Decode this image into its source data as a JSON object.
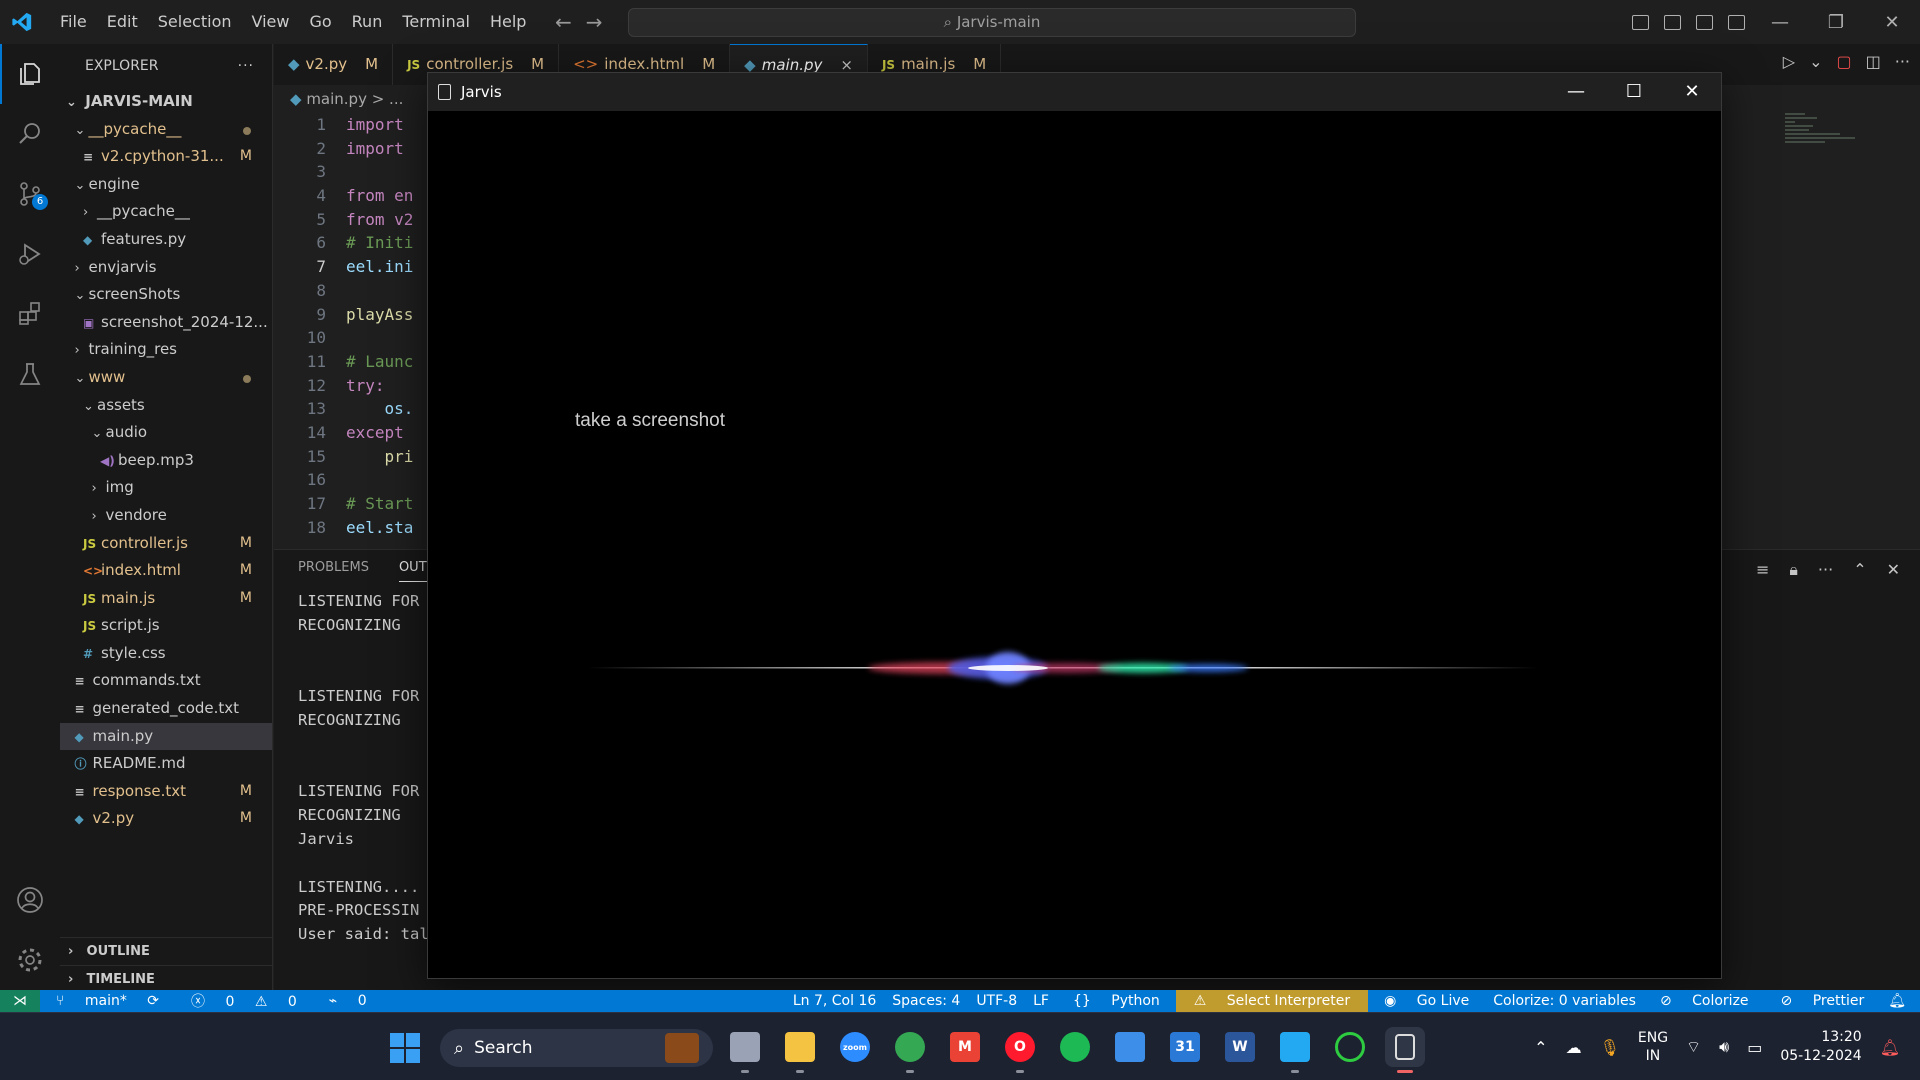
{
  "menu": [
    "File",
    "Edit",
    "Selection",
    "View",
    "Go",
    "Run",
    "Terminal",
    "Help"
  ],
  "command_center": "Jarvis-main",
  "explorer": {
    "title": "EXPLORER",
    "root": "JARVIS-MAIN",
    "items": [
      {
        "label": "__pycache__",
        "indent": 1,
        "kind": "folder-open",
        "mark": "dot",
        "mod": true
      },
      {
        "label": "v2.cpython-31...",
        "indent": 2,
        "kind": "file",
        "icon": "≡",
        "mark": "M",
        "mod": true
      },
      {
        "label": "engine",
        "indent": 1,
        "kind": "folder-open"
      },
      {
        "label": "__pycache__",
        "indent": 2,
        "kind": "folder"
      },
      {
        "label": "features.py",
        "indent": 2,
        "kind": "file",
        "icon": "py"
      },
      {
        "label": "envjarvis",
        "indent": 1,
        "kind": "folder"
      },
      {
        "label": "screenShots",
        "indent": 1,
        "kind": "folder-open"
      },
      {
        "label": "screenshot_2024-12...",
        "indent": 2,
        "kind": "file",
        "icon": "img"
      },
      {
        "label": "training_res",
        "indent": 1,
        "kind": "folder"
      },
      {
        "label": "www",
        "indent": 1,
        "kind": "folder-open",
        "mark": "dot",
        "mod": true
      },
      {
        "label": "assets",
        "indent": 2,
        "kind": "folder-open"
      },
      {
        "label": "audio",
        "indent": 3,
        "kind": "folder-open"
      },
      {
        "label": "beep.mp3",
        "indent": 4,
        "kind": "file",
        "icon": "audio"
      },
      {
        "label": "img",
        "indent": 3,
        "kind": "folder"
      },
      {
        "label": "vendore",
        "indent": 3,
        "kind": "folder"
      },
      {
        "label": "controller.js",
        "indent": 2,
        "kind": "file",
        "icon": "JS",
        "mark": "M",
        "mod": true
      },
      {
        "label": "index.html",
        "indent": 2,
        "kind": "file",
        "icon": "<>",
        "mark": "M",
        "mod": true
      },
      {
        "label": "main.js",
        "indent": 2,
        "kind": "file",
        "icon": "JS",
        "mark": "M",
        "mod": true
      },
      {
        "label": "script.js",
        "indent": 2,
        "kind": "file",
        "icon": "JS"
      },
      {
        "label": "style.css",
        "indent": 2,
        "kind": "file",
        "icon": "#"
      },
      {
        "label": "commands.txt",
        "indent": 1,
        "kind": "file",
        "icon": "≡"
      },
      {
        "label": "generated_code.txt",
        "indent": 1,
        "kind": "file",
        "icon": "≡"
      },
      {
        "label": "main.py",
        "indent": 1,
        "kind": "file",
        "icon": "py",
        "selected": true
      },
      {
        "label": "README.md",
        "indent": 1,
        "kind": "file",
        "icon": "i"
      },
      {
        "label": "response.txt",
        "indent": 1,
        "kind": "file",
        "icon": "≡",
        "mark": "M",
        "mod": true
      },
      {
        "label": "v2.py",
        "indent": 1,
        "kind": "file",
        "icon": "py",
        "mark": "M",
        "mod": true
      }
    ],
    "outline": "OUTLINE",
    "timeline": "TIMELINE"
  },
  "scm_badge": "6",
  "tabs": [
    {
      "label": "v2.py",
      "icon": "py",
      "mark": "M"
    },
    {
      "label": "controller.js",
      "icon": "JS",
      "mark": "M"
    },
    {
      "label": "index.html",
      "icon": "<>",
      "mark": "M"
    },
    {
      "label": "main.py",
      "icon": "py",
      "mark": "×",
      "active": true
    },
    {
      "label": "main.js",
      "icon": "JS",
      "mark": "M"
    }
  ],
  "breadcrumb": "main.py > ...",
  "code_lines": [
    {
      "n": "1",
      "t": "import ",
      "c": "kw"
    },
    {
      "n": "2",
      "t": "import ",
      "c": "kw"
    },
    {
      "n": "3",
      "t": "",
      "c": ""
    },
    {
      "n": "4",
      "t": "from en",
      "c": "kw"
    },
    {
      "n": "5",
      "t": "from v2",
      "c": "kw"
    },
    {
      "n": "6",
      "t": "# Initi",
      "c": "cmt"
    },
    {
      "n": "7",
      "t": "eel.ini",
      "c": "id"
    },
    {
      "n": "8",
      "t": "",
      "c": ""
    },
    {
      "n": "9",
      "t": "playAss",
      "c": "fn"
    },
    {
      "n": "10",
      "t": "",
      "c": ""
    },
    {
      "n": "11",
      "t": "# Launc",
      "c": "cmt"
    },
    {
      "n": "12",
      "t": "try:",
      "c": "kw"
    },
    {
      "n": "13",
      "t": "    os.",
      "c": "id"
    },
    {
      "n": "14",
      "t": "except ",
      "c": "kw"
    },
    {
      "n": "15",
      "t": "    pri",
      "c": "fn"
    },
    {
      "n": "16",
      "t": "",
      "c": ""
    },
    {
      "n": "17",
      "t": "# Start",
      "c": "cmt"
    },
    {
      "n": "18",
      "t": "eel.sta",
      "c": "id"
    }
  ],
  "panel": {
    "tabs": [
      "PROBLEMS",
      "OUTP"
    ],
    "output": [
      "LISTENING FOR",
      "RECOGNIZING",
      "",
      "",
      "LISTENING FOR",
      "RECOGNIZING",
      "",
      "",
      "LISTENING FOR",
      "RECOGNIZING",
      "Jarvis",
      "",
      "LISTENING....",
      "PRE-PROCESSIN",
      "User said: tal"
    ]
  },
  "jarvis": {
    "title": "Jarvis",
    "text": "take a screenshot"
  },
  "status": {
    "branch": "main*",
    "errors": "0",
    "warnings": "0",
    "ports": "0",
    "position": "Ln 7, Col 16",
    "spaces": "Spaces: 4",
    "encoding": "UTF-8",
    "eol": "LF",
    "language": "Python",
    "interpreter": "Select Interpreter",
    "go_live": "Go Live",
    "colorize_vars": "Colorize: 0 variables",
    "colorize": "Colorize",
    "prettier": "Prettier"
  },
  "taskbar": {
    "search": "Search",
    "apps": [
      {
        "name": "task-view",
        "label": "",
        "color": "#9aa3b5"
      },
      {
        "name": "file-explorer",
        "label": "",
        "color": "#f5c342"
      },
      {
        "name": "zoom",
        "label": "zoom",
        "color": "#2d8cff"
      },
      {
        "name": "chrome",
        "label": "",
        "color": "#34a853"
      },
      {
        "name": "gmail",
        "label": "M",
        "color": "#ea4335"
      },
      {
        "name": "opera",
        "label": "O",
        "color": "#ff1b2d"
      },
      {
        "name": "spotify",
        "label": "",
        "color": "#1db954"
      },
      {
        "name": "notepad",
        "label": "",
        "color": "#3d8ee8"
      },
      {
        "name": "calendar",
        "label": "31",
        "color": "#2b79d6"
      },
      {
        "name": "word",
        "label": "W",
        "color": "#2b579a"
      },
      {
        "name": "vscode",
        "label": "",
        "color": "#23a9f2"
      },
      {
        "name": "loader-app",
        "label": "",
        "color": "#2ecc40"
      },
      {
        "name": "jarvis-app",
        "label": "",
        "color": "#dddddd"
      }
    ],
    "lang1": "ENG",
    "lang2": "IN",
    "time": "13:20",
    "date": "05-12-2024"
  },
  "colors": {
    "accent": "#0078d4",
    "modified": "#e2c08d",
    "status_bar": "#0078d4",
    "remote": "#16825d"
  }
}
